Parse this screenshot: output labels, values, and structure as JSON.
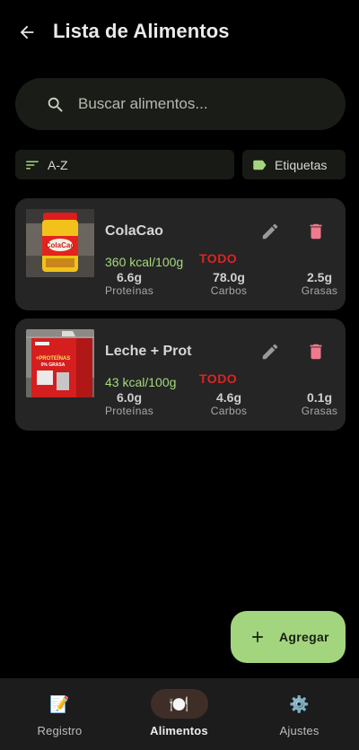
{
  "header": {
    "title": "Lista de Alimentos",
    "back_icon": "arrow-back-icon"
  },
  "search": {
    "placeholder": "Buscar alimentos...",
    "value": "",
    "icon": "search-icon"
  },
  "filters": {
    "sort_label": "A-Z",
    "sort_icon": "sort-icon",
    "tags_label": "Etiquetas",
    "tags_icon": "label-icon"
  },
  "foods": [
    {
      "name": "ColaCao",
      "kcal": "360 kcal/100g",
      "status": "TODO",
      "macros": [
        {
          "value": "6.6g",
          "label": "Proteínas"
        },
        {
          "value": "78.0g",
          "label": "Carbos"
        },
        {
          "value": "2.5g",
          "label": "Grasas"
        }
      ]
    },
    {
      "name": "Leche + Prot",
      "kcal": "43 kcal/100g",
      "status": "TODO",
      "macros": [
        {
          "value": "6.0g",
          "label": "Proteínas"
        },
        {
          "value": "4.6g",
          "label": "Carbos"
        },
        {
          "value": "0.1g",
          "label": "Grasas"
        }
      ]
    }
  ],
  "fab": {
    "label": "Agregar",
    "icon": "plus-icon"
  },
  "nav": [
    {
      "label": "Registro",
      "icon": "📝",
      "icon_name": "memo-icon"
    },
    {
      "label": "Alimentos",
      "icon": "🍽️",
      "icon_name": "plate-icon",
      "active": true
    },
    {
      "label": "Ajustes",
      "icon": "⚙️",
      "icon_name": "gear-icon"
    }
  ],
  "colors": {
    "background": "#000000",
    "surface": "#252525",
    "accent": "#a3d57f",
    "kcal": "#a4d97e",
    "todo": "#e02222",
    "delete": "#f07a8c"
  }
}
